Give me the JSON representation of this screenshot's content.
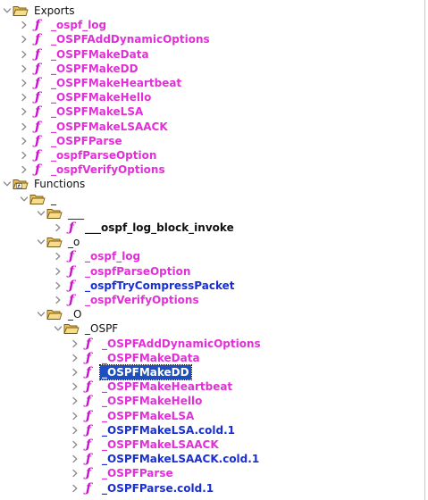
{
  "colors": {
    "function_magenta": "#e22fd8",
    "function_blue": "#1a2fd0",
    "selection": "#1f4fbf",
    "folder_yellow": "#f2d06b"
  },
  "tree": [
    {
      "label": "Exports",
      "kind": "folder",
      "depth": 0,
      "expanded": true,
      "style": "plain",
      "icon": "open-folder-icon"
    },
    {
      "label": "_ospf_log",
      "kind": "function",
      "depth": 1,
      "style": "magenta"
    },
    {
      "label": "_OSPFAddDynamicOptions",
      "kind": "function",
      "depth": 1,
      "style": "magenta"
    },
    {
      "label": "_OSPFMakeData",
      "kind": "function",
      "depth": 1,
      "style": "magenta"
    },
    {
      "label": "_OSPFMakeDD",
      "kind": "function",
      "depth": 1,
      "style": "magenta"
    },
    {
      "label": "_OSPFMakeHeartbeat",
      "kind": "function",
      "depth": 1,
      "style": "magenta"
    },
    {
      "label": "_OSPFMakeHello",
      "kind": "function",
      "depth": 1,
      "style": "magenta"
    },
    {
      "label": "_OSPFMakeLSA",
      "kind": "function",
      "depth": 1,
      "style": "magenta"
    },
    {
      "label": "_OSPFMakeLSAACK",
      "kind": "function",
      "depth": 1,
      "style": "magenta"
    },
    {
      "label": "_OSPFParse",
      "kind": "function",
      "depth": 1,
      "style": "magenta"
    },
    {
      "label": "_ospfParseOption",
      "kind": "function",
      "depth": 1,
      "style": "magenta"
    },
    {
      "label": "_ospfVerifyOptions",
      "kind": "function",
      "depth": 1,
      "style": "magenta"
    },
    {
      "label": "Functions",
      "kind": "folder",
      "depth": 0,
      "expanded": true,
      "style": "plain",
      "icon": "functions-folder-icon"
    },
    {
      "label": "_",
      "kind": "folder",
      "depth": 1,
      "expanded": true,
      "style": "plain",
      "icon": "open-folder-icon"
    },
    {
      "label": "___",
      "kind": "folder",
      "depth": 2,
      "expanded": true,
      "style": "plain",
      "icon": "open-folder-icon"
    },
    {
      "label": "___ospf_log_block_invoke",
      "kind": "function",
      "depth": 3,
      "style": "black"
    },
    {
      "label": "_o",
      "kind": "folder",
      "depth": 2,
      "expanded": true,
      "style": "plain",
      "icon": "open-folder-icon"
    },
    {
      "label": "_ospf_log",
      "kind": "function",
      "depth": 3,
      "style": "magenta"
    },
    {
      "label": "_ospfParseOption",
      "kind": "function",
      "depth": 3,
      "style": "magenta"
    },
    {
      "label": "_ospfTryCompressPacket",
      "kind": "function",
      "depth": 3,
      "style": "blue"
    },
    {
      "label": "_ospfVerifyOptions",
      "kind": "function",
      "depth": 3,
      "style": "magenta"
    },
    {
      "label": "_O",
      "kind": "folder",
      "depth": 2,
      "expanded": true,
      "style": "plain",
      "icon": "open-folder-icon"
    },
    {
      "label": "_OSPF",
      "kind": "folder",
      "depth": 3,
      "expanded": true,
      "style": "plain",
      "icon": "open-folder-icon"
    },
    {
      "label": "_OSPFAddDynamicOptions",
      "kind": "function",
      "depth": 4,
      "style": "magenta"
    },
    {
      "label": "_OSPFMakeData",
      "kind": "function",
      "depth": 4,
      "style": "magenta"
    },
    {
      "label": "_OSPFMakeDD",
      "kind": "function",
      "depth": 4,
      "style": "magenta",
      "selected": true
    },
    {
      "label": "_OSPFMakeHeartbeat",
      "kind": "function",
      "depth": 4,
      "style": "magenta"
    },
    {
      "label": "_OSPFMakeHello",
      "kind": "function",
      "depth": 4,
      "style": "magenta"
    },
    {
      "label": "_OSPFMakeLSA",
      "kind": "function",
      "depth": 4,
      "style": "magenta"
    },
    {
      "label": "_OSPFMakeLSA.cold.1",
      "kind": "function",
      "depth": 4,
      "style": "blue"
    },
    {
      "label": "_OSPFMakeLSAACK",
      "kind": "function",
      "depth": 4,
      "style": "magenta"
    },
    {
      "label": "_OSPFMakeLSAACK.cold.1",
      "kind": "function",
      "depth": 4,
      "style": "blue"
    },
    {
      "label": "_OSPFParse",
      "kind": "function",
      "depth": 4,
      "style": "magenta"
    },
    {
      "label": "_OSPFParse.cold.1",
      "kind": "function",
      "depth": 4,
      "style": "blue"
    }
  ]
}
